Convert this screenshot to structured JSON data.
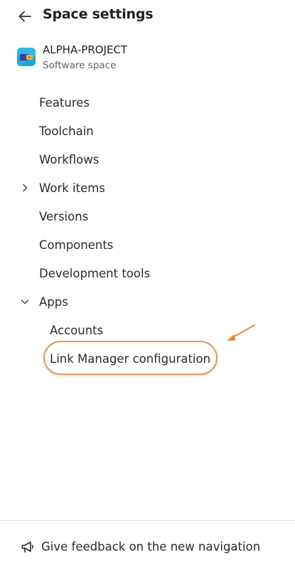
{
  "header": {
    "back_icon": "arrow-left-icon",
    "title": "Space settings"
  },
  "space": {
    "avatar_icon": "software-space-avatar-icon",
    "name": "ALPHA-PROJECT",
    "type": "Software space"
  },
  "nav": {
    "items": [
      {
        "label": "Features"
      },
      {
        "label": "Toolchain"
      },
      {
        "label": "Workflows"
      },
      {
        "label": "Work items",
        "icon": "chevron-right-icon",
        "expanded": false
      },
      {
        "label": "Versions"
      },
      {
        "label": "Components"
      },
      {
        "label": "Development tools"
      },
      {
        "label": "Apps",
        "icon": "chevron-down-icon",
        "expanded": true
      }
    ],
    "apps_children": [
      {
        "label": "Accounts"
      },
      {
        "label": "Link Manager configuration",
        "highlighted": true
      }
    ]
  },
  "annotation": {
    "color": "#dc9b62",
    "arrow_icon": "pointer-arrow-icon"
  },
  "footer": {
    "icon": "megaphone-icon",
    "feedback_label": "Give feedback on the new navigation"
  }
}
